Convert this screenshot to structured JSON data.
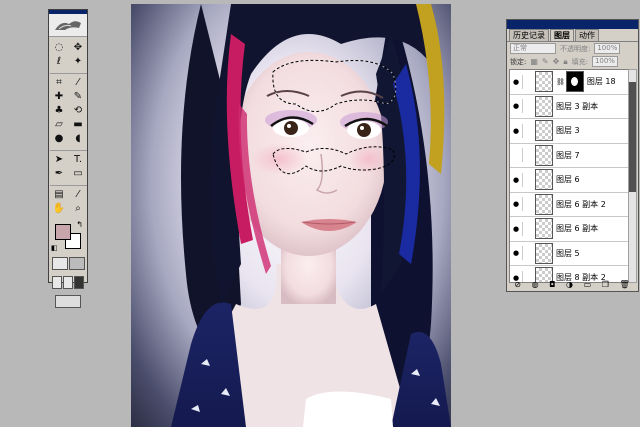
{
  "toolbox": {
    "tools": [
      {
        "name": "marquee-tool",
        "glyph": "◌"
      },
      {
        "name": "move-tool",
        "glyph": "✥"
      },
      {
        "name": "lasso-tool",
        "glyph": "ℓ"
      },
      {
        "name": "magic-wand-tool",
        "glyph": "✦"
      },
      {
        "name": "crop-tool",
        "glyph": "⌗"
      },
      {
        "name": "slice-tool",
        "glyph": "⁄"
      },
      {
        "name": "healing-brush-tool",
        "glyph": "✚"
      },
      {
        "name": "brush-tool",
        "glyph": "✎"
      },
      {
        "name": "clone-stamp-tool",
        "glyph": "♣"
      },
      {
        "name": "history-brush-tool",
        "glyph": "⟲"
      },
      {
        "name": "eraser-tool",
        "glyph": "▱"
      },
      {
        "name": "gradient-tool",
        "glyph": "▬"
      },
      {
        "name": "blur-tool",
        "glyph": "●"
      },
      {
        "name": "dodge-tool",
        "glyph": "◖"
      },
      {
        "name": "path-selection-tool",
        "glyph": "➤"
      },
      {
        "name": "type-tool",
        "glyph": "T."
      },
      {
        "name": "pen-tool",
        "glyph": "✒"
      },
      {
        "name": "rectangle-tool",
        "glyph": "▭"
      },
      {
        "name": "notes-tool",
        "glyph": "▤"
      },
      {
        "name": "eyedropper-tool",
        "glyph": "⁄"
      },
      {
        "name": "hand-tool",
        "glyph": "✋"
      },
      {
        "name": "zoom-tool",
        "glyph": "⌕"
      }
    ],
    "foreground_color": "#c9a6ac",
    "background_color": "#ffffff"
  },
  "layers_panel": {
    "tabs": [
      {
        "label": "历史记录",
        "active": false
      },
      {
        "label": "图层",
        "active": true
      },
      {
        "label": "动作",
        "active": false
      }
    ],
    "blend_mode": "正常",
    "opacity_label": "不透明度:",
    "opacity_value": "100%",
    "lock_label": "锁定:",
    "fill_label": "填充:",
    "fill_value": "100%",
    "layers": [
      {
        "name": "图层 18",
        "visible": true,
        "has_mask": true
      },
      {
        "name": "图层 3 副本",
        "visible": true,
        "has_mask": false
      },
      {
        "name": "图层 3",
        "visible": true,
        "has_mask": false
      },
      {
        "name": "图层 7",
        "visible": false,
        "has_mask": false
      },
      {
        "name": "图层 6",
        "visible": true,
        "has_mask": false
      },
      {
        "name": "图层 6 副本 2",
        "visible": true,
        "has_mask": false
      },
      {
        "name": "图层 6 副本",
        "visible": true,
        "has_mask": false
      },
      {
        "name": "图层 5",
        "visible": true,
        "has_mask": false
      },
      {
        "name": "图层 8 副本 2",
        "visible": true,
        "has_mask": false
      }
    ],
    "footer_icons": [
      "link-icon",
      "fx-icon",
      "mask-icon",
      "adjustment-icon",
      "folder-icon",
      "new-layer-icon",
      "trash-icon"
    ]
  }
}
